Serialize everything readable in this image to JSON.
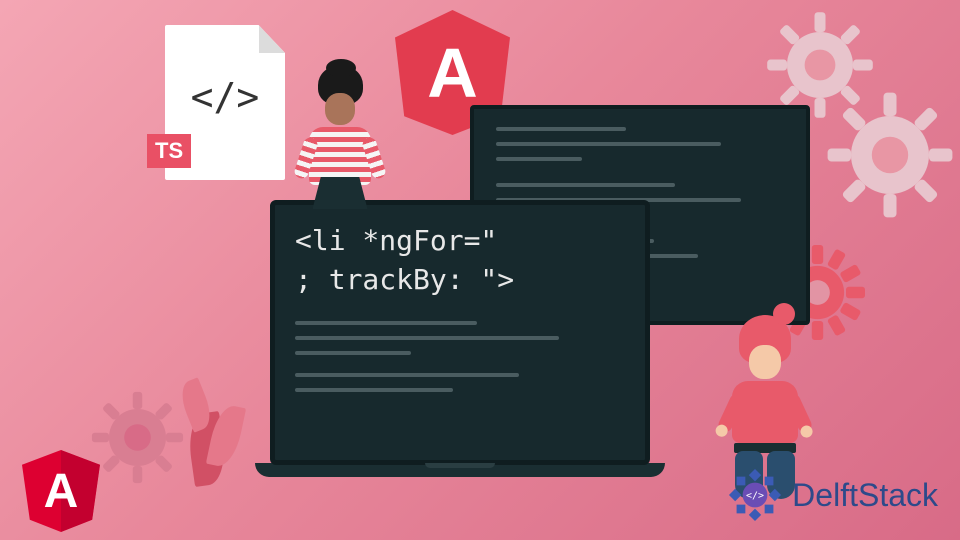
{
  "file": {
    "code_symbol": "</>",
    "badge": "TS"
  },
  "angular_hex": {
    "letter": "A"
  },
  "laptop_code": {
    "line1": "<li *ngFor=\"",
    "line2": "; trackBy: \">"
  },
  "angular_badge": {
    "letter": "A"
  },
  "brand": {
    "name": "DelftStack"
  }
}
